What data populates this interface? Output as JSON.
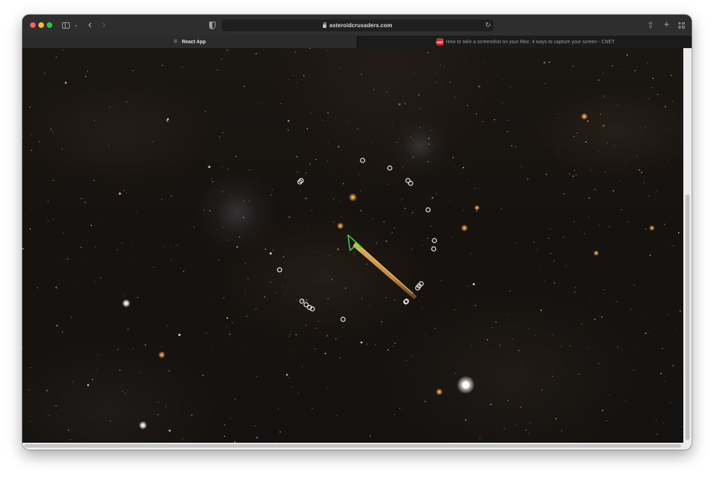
{
  "browser": {
    "address": "asteroidcrusaders.com",
    "tabs": [
      {
        "title": "React App",
        "active": true,
        "favicon": "react-icon"
      },
      {
        "title": "How to take a screenshot on your Mac: 4 ways to capture your screen - CNET",
        "active": false,
        "favicon": "cnet-icon",
        "favicon_text": "CNET"
      }
    ],
    "icons": {
      "sidebar": "sidebar-icon",
      "sidebar_menu": "chevron-down-icon",
      "back": "chevron-left-icon",
      "forward": "chevron-right-icon",
      "privacy": "shield-icon",
      "lock": "lock-icon",
      "reload": "reload-icon",
      "share": "share-icon",
      "new_tab": "plus-icon",
      "tab_overview": "grid-icon"
    },
    "glyphs": {
      "menu": "⌄",
      "back": "‹",
      "forward": "›",
      "reload": "↻",
      "share": "⇧",
      "new_tab": "+",
      "react": "⚛"
    }
  },
  "game": {
    "ship_color": "#3de23d",
    "thrust_color": "#e0a04a",
    "asteroid_color": "#f2f2f2",
    "ship_heading": "up-left",
    "asteroid_count": 26
  }
}
